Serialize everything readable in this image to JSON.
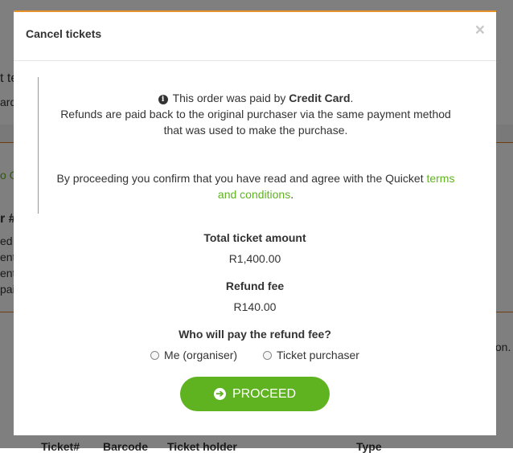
{
  "background": {
    "fragments": [
      "t te",
      "ard",
      "o G",
      "r #",
      "ed",
      "ent",
      "ent",
      "pai",
      "ton.",
      "Ticket#",
      "Barcode",
      "Ticket holder",
      "Type"
    ]
  },
  "modal": {
    "title": "Cancel tickets",
    "close_label": "×",
    "notice": {
      "paid_prefix": "This order was paid by ",
      "paid_method": "Credit Card",
      "paid_suffix": ".",
      "refund_line1": "Refunds are paid back to the original purchaser via the same payment method",
      "refund_line2": "that was used to make the purchase.",
      "agree_prefix": "By proceeding you confirm that you have read and agree with the Quicket ",
      "terms_link_part1": "terms",
      "terms_link_part2": "and conditions",
      "agree_suffix": "."
    },
    "total_label": "Total ticket amount",
    "total_value": "R1,400.00",
    "fee_label": "Refund fee",
    "fee_value": "R140.00",
    "payer_question": "Who will pay the refund fee?",
    "payer_options": [
      "Me (organiser)",
      "Ticket purchaser"
    ],
    "proceed_label": "PROCEED"
  },
  "colors": {
    "accent": "#5fb320",
    "top_border": "#e8902a"
  },
  "icons": {
    "info": "info-circle-icon",
    "arrow": "arrow-right-icon",
    "close": "close-icon"
  }
}
